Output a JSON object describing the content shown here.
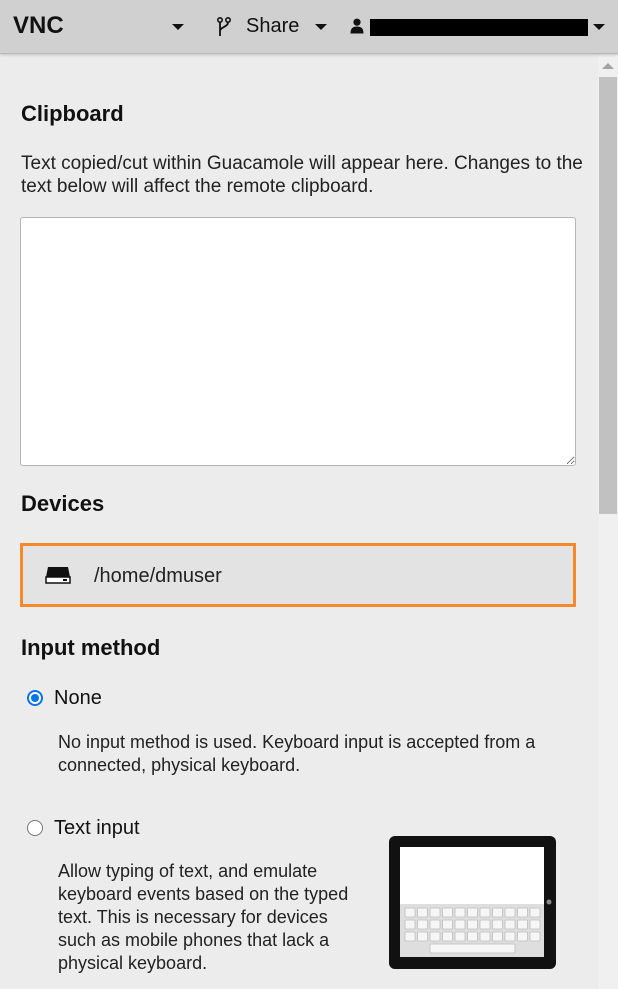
{
  "header": {
    "connection_name": "VNC",
    "share_label": "Share",
    "user_name": "[redacted]"
  },
  "clipboard": {
    "title": "Clipboard",
    "description": "Text copied/cut within Guacamole will appear here. Changes to the text below will affect the remote clipboard.",
    "value": ""
  },
  "devices": {
    "title": "Devices",
    "items": [
      {
        "label": "/home/dmuser",
        "icon": "drive-icon"
      }
    ]
  },
  "input_method": {
    "title": "Input method",
    "options": [
      {
        "label": "None",
        "checked": true,
        "description": "No input method is used. Keyboard input is accepted from a connected, physical keyboard."
      },
      {
        "label": "Text input",
        "checked": false,
        "description": "Allow typing of text, and emulate keyboard events based on the typed text. This is necessary for devices such as mobile phones that lack a physical keyboard."
      }
    ]
  },
  "colors": {
    "header_bg": "#d0d0d0",
    "panel_bg": "#ececec",
    "highlight_border": "#f5892b",
    "radio_accent": "#0a73e8"
  }
}
